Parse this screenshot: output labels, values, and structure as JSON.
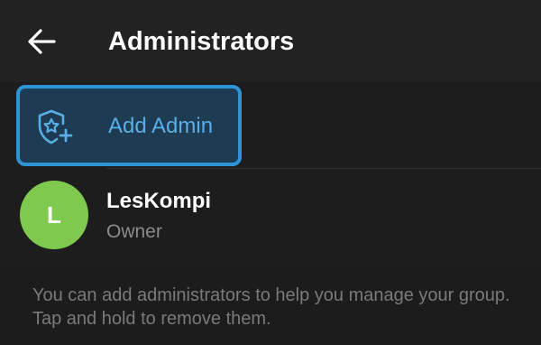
{
  "header": {
    "title": "Administrators",
    "back_icon": "arrow-left-icon"
  },
  "add_admin": {
    "label": "Add Admin",
    "icon": "shield-star-plus-icon",
    "accent_color": "#2d94d6"
  },
  "members": [
    {
      "initial": "L",
      "name": "LesKompi",
      "role": "Owner",
      "avatar_color": "#7ec94e"
    }
  ],
  "info_text": "You can add administrators to help you manage your group. Tap and hold to remove them."
}
